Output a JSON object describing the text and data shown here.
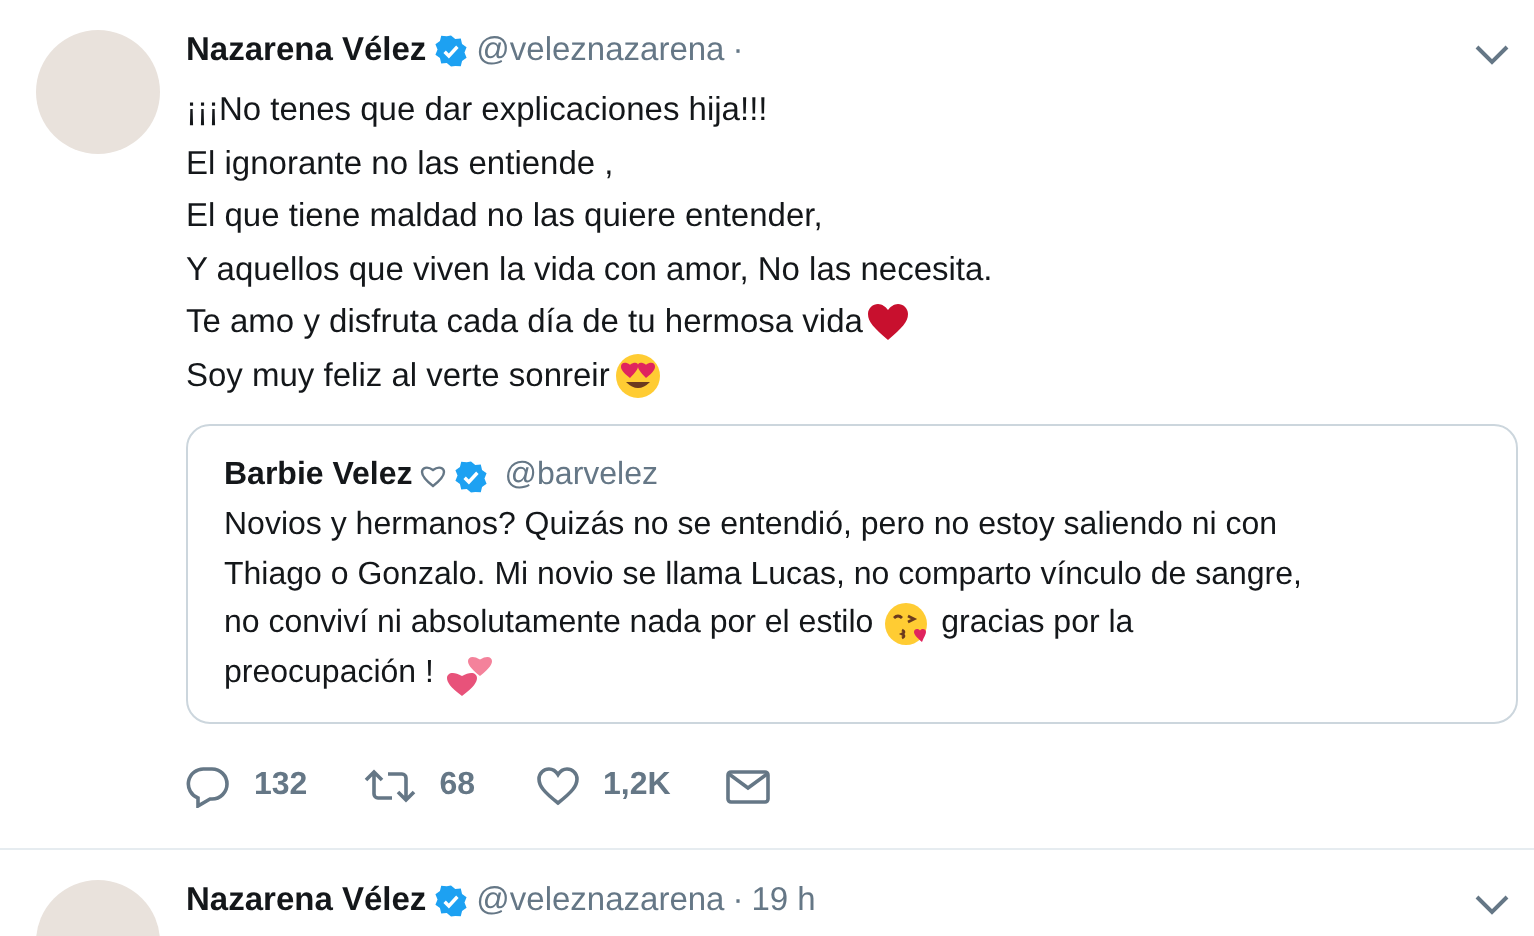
{
  "tweets": [
    {
      "author": {
        "name": "Nazarena Vélez",
        "handle": "@veleznazarena",
        "verified": true,
        "separator": "·"
      },
      "lines": [
        [
          {
            "text": "¡¡¡No tenes que dar explicaciones hija!!!"
          }
        ],
        [
          {
            "text": "El ignorante no las entiende ,"
          }
        ],
        [
          {
            "text": "El que tiene maldad no las quiere entender,"
          }
        ],
        [
          {
            "text": "Y aquellos que viven la vida con amor, No las necesita."
          }
        ],
        [
          {
            "text": "Te amo y disfruta cada día de tu hermosa vida"
          },
          {
            "kind": "heart"
          }
        ],
        [
          {
            "text": "Soy muy feliz al verte sonreir"
          },
          {
            "kind": "hearteyes"
          }
        ]
      ],
      "quote": {
        "author": {
          "name": "Barbie Velez",
          "handle": "@barvelez",
          "verified": true
        },
        "lines": [
          [
            {
              "text": "Novios y hermanos? Quizás no se entendió, pero no estoy saliendo ni con"
            }
          ],
          [
            {
              "text": "Thiago o Gonzalo. Mi novio se llama Lucas, no comparto vínculo de sangre,"
            }
          ],
          [
            {
              "text": "no conviví ni absolutamente nada por el estilo"
            },
            {
              "kind": "kiss"
            },
            {
              "text": "gracias por la"
            }
          ],
          [
            {
              "text": "preocupación !"
            },
            {
              "kind": "hearts"
            }
          ]
        ]
      },
      "actions": {
        "replies": "132",
        "retweets": "68",
        "likes": "1,2K"
      }
    },
    {
      "author": {
        "name": "Nazarena Vélez",
        "handle": "@veleznazarena",
        "verified": true,
        "separator": "·",
        "time": "19 h"
      }
    }
  ]
}
